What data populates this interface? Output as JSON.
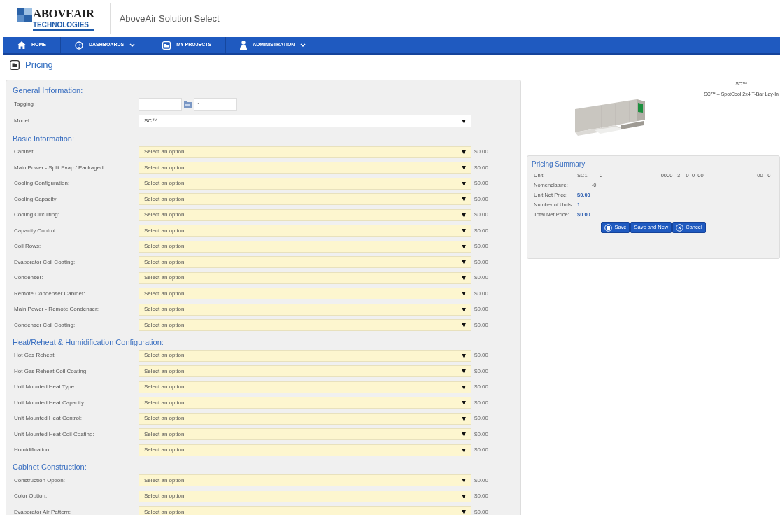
{
  "header": {
    "logo_top": "ABOVEAIR",
    "logo_bottom": "TECHNOLOGIES",
    "app_title": "AboveAir Solution Select"
  },
  "nav": [
    {
      "label": "HOME",
      "dropdown": false
    },
    {
      "label": "DASHBOARDS",
      "dropdown": true
    },
    {
      "label": "MY PROJECTS",
      "dropdown": false
    },
    {
      "label": "ADMINISTRATION",
      "dropdown": true
    }
  ],
  "page_title": "Pricing",
  "sections": [
    {
      "title": "General Information:",
      "rows": [
        {
          "kind": "tagging",
          "label": "Tagging :",
          "value": "1"
        },
        {
          "kind": "model",
          "label": "Model:",
          "value": "SC™"
        }
      ]
    },
    {
      "title": "Basic Information:",
      "rows": [
        {
          "kind": "select",
          "label": "Cabinet:",
          "placeholder": "Select an option",
          "price": "$0.00"
        },
        {
          "kind": "select",
          "label": "Main Power - Split Evap / Packaged:",
          "placeholder": "Select an option",
          "price": "$0.00"
        },
        {
          "kind": "select",
          "label": "Cooling Configuration:",
          "placeholder": "Select an option",
          "price": "$0.00"
        },
        {
          "kind": "select",
          "label": "Cooling Capacity:",
          "placeholder": "Select an option",
          "price": "$0.00"
        },
        {
          "kind": "select",
          "label": "Cooling Circuiting:",
          "placeholder": "Select an option",
          "price": "$0.00"
        },
        {
          "kind": "select",
          "label": "Capacity Control:",
          "placeholder": "Select an option",
          "price": "$0.00"
        },
        {
          "kind": "select",
          "label": "Coil Rows:",
          "placeholder": "Select an option",
          "price": "$0.00"
        },
        {
          "kind": "select",
          "label": "Evaporator Coil Coating:",
          "placeholder": "Select an option",
          "price": "$0.00"
        },
        {
          "kind": "select",
          "label": "Condenser:",
          "placeholder": "Select an option",
          "price": "$0.00"
        },
        {
          "kind": "select",
          "label": "Remote Condenser Cabinet:",
          "placeholder": "Select an option",
          "price": "$0.00"
        },
        {
          "kind": "select",
          "label": "Main Power - Remote Condenser:",
          "placeholder": "Select an option",
          "price": "$0.00"
        },
        {
          "kind": "select",
          "label": "Condenser Coil Coating:",
          "placeholder": "Select an option",
          "price": "$0.00"
        }
      ]
    },
    {
      "title": "Heat/Reheat & Humidification Configuration:",
      "rows": [
        {
          "kind": "select",
          "label": "Hot Gas Reheat:",
          "placeholder": "Select an option",
          "price": "$0.00"
        },
        {
          "kind": "select",
          "label": "Hot Gas Reheat Coil Coating:",
          "placeholder": "Select an option",
          "price": "$0.00"
        },
        {
          "kind": "select",
          "label": "Unit Mounted Heat Type:",
          "placeholder": "Select an option",
          "price": "$0.00"
        },
        {
          "kind": "select",
          "label": "Unit Mounted Heat Capacity:",
          "placeholder": "Select an option",
          "price": "$0.00"
        },
        {
          "kind": "select",
          "label": "Unit Mounted Heat Control:",
          "placeholder": "Select an option",
          "price": "$0.00"
        },
        {
          "kind": "select",
          "label": "Unit Mounted Heat Coil Coating:",
          "placeholder": "Select an option",
          "price": "$0.00"
        },
        {
          "kind": "select",
          "label": "Humidification:",
          "placeholder": "Select an option",
          "price": "$0.00"
        }
      ]
    },
    {
      "title": "Cabinet Construction:",
      "rows": [
        {
          "kind": "select",
          "label": "Construction Option:",
          "placeholder": "Select an option",
          "price": "$0.00"
        },
        {
          "kind": "select",
          "label": "Color Option:",
          "placeholder": "Select an option",
          "price": "$0.00"
        },
        {
          "kind": "select",
          "label": "Evaporator Air Pattern:",
          "placeholder": "Select an option",
          "price": "$0.00"
        }
      ]
    }
  ],
  "product": {
    "name": "SC™",
    "description": "SC™ – SpotCool 2x4 T-Bar Lay-In"
  },
  "summary": {
    "title": "Pricing Summary",
    "fields": [
      {
        "label": "Unit",
        "value": "SC1_-_-_0-____-_____-_-_-______0000_-3__0_0_00-_______-_____-____-00-_0-",
        "kind": "plain"
      },
      {
        "label": "Nomenclature:",
        "value": "_____-0________",
        "kind": "plain"
      },
      {
        "label": "Unit Net Price:",
        "value": "$0.00",
        "kind": "accent"
      },
      {
        "label": "Number of Units:",
        "value": "1",
        "kind": "accent"
      },
      {
        "label": "Total Net Price:",
        "value": "$0.00",
        "kind": "accent"
      }
    ],
    "buttons": [
      "Save",
      "Save and New",
      "Cancel"
    ]
  }
}
